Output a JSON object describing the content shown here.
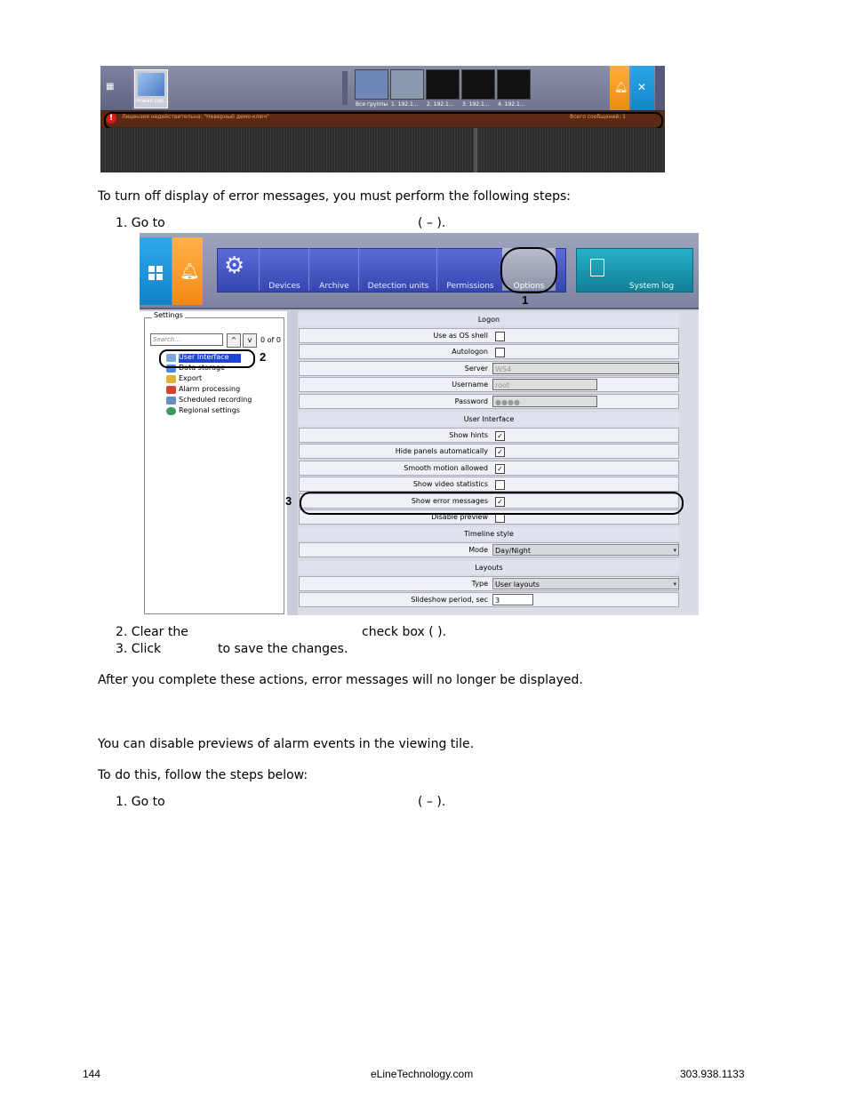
{
  "screenshot1": {
    "thumb_label": "Новая рас...",
    "group_label": "Все группы",
    "cameras": [
      "1. 192.1...",
      "2. 192.1...",
      "3. 192.1...",
      "4. 192.1..."
    ],
    "error_text": "Лицензия недействительна: \"Неверный демо-ключ\"",
    "error_count": "Всего сообщений: 1",
    "colors": {
      "error_bar": "#5a2a14",
      "error_icon": "#d41c1c",
      "orange": "#f08a10",
      "blue": "#1585c8"
    }
  },
  "paragraphs": {
    "p1": "To turn off display of error messages, you must perform the following steps:",
    "step1a": "1.  Go to",
    "step1a_paren": "(  –  ).",
    "step2a": "2.  Clear the",
    "step2a_tail": "check box (   ).",
    "step3a": "3.  Click",
    "step3a_tail": "to save the changes.",
    "p2": "After you complete these actions, error messages will no longer be displayed.",
    "p3": "You can disable previews of alarm events in the viewing tile.",
    "p4": "To do this, follow the steps below:",
    "step1b": "1.  Go to",
    "step1b_paren": "(  –  )."
  },
  "screenshot2": {
    "toolbar": {
      "buttons": [
        "Devices",
        "Archive",
        "Detection units",
        "Permissions"
      ],
      "options": "Options",
      "system_log": "System log"
    },
    "callouts": {
      "one": "1",
      "two": "2",
      "three": "3"
    },
    "settings": {
      "title": "Settings",
      "search_placeholder": "Search...",
      "up": "^",
      "down": "v",
      "count": "0 of 0",
      "tree": [
        "User Interface",
        "Data storage",
        "Export",
        "Alarm processing",
        "Scheduled recording",
        "Regional settings"
      ]
    },
    "logon": {
      "header": "Logon",
      "use_as_os_shell": "Use as OS shell",
      "autologon": "Autologon",
      "server": "Server",
      "server_value": "WS4",
      "username": "Username",
      "username_value": "root",
      "password": "Password",
      "password_value": "●●●●"
    },
    "ui": {
      "header": "User Interface",
      "show_hints": "Show hints",
      "hide_panels": "Hide panels automatically",
      "smooth_motion": "Smooth motion allowed",
      "show_video_stats": "Show video statistics",
      "show_error_messages": "Show error messages",
      "disable_preview": "Disable preview",
      "check": "✓"
    },
    "timeline": {
      "header": "Timeline style",
      "mode": "Mode",
      "mode_value": "Day/Night"
    },
    "layouts": {
      "header": "Layouts",
      "type": "Type",
      "type_value": "User layouts",
      "slideshow": "Slideshow period, sec",
      "slideshow_value": "3"
    }
  },
  "footer": {
    "page": "144",
    "site": "eLineTechnology.com",
    "phone": "303.938.1133"
  }
}
